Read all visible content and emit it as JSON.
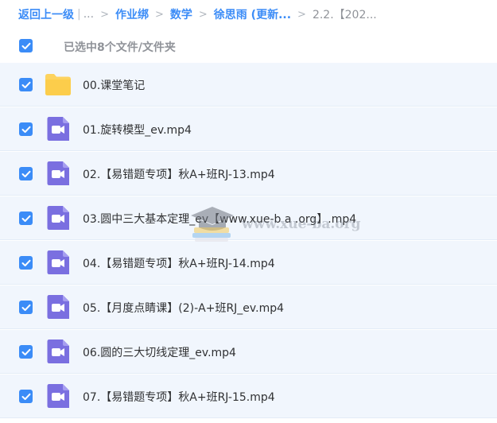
{
  "breadcrumb": {
    "back_label": "返回上一级",
    "bar": "|",
    "ellipsis": "...",
    "separator": ">",
    "items": [
      "作业绑",
      "数学",
      "徐思雨 (更新...",
      "2.2.【202..."
    ]
  },
  "selection": {
    "label": "已选中8个文件/文件夹",
    "checked": true
  },
  "files": [
    {
      "name": "00.课堂笔记",
      "type": "folder",
      "checked": true
    },
    {
      "name": "01.旋转模型_ev.mp4",
      "type": "video",
      "checked": true
    },
    {
      "name": "02.【易错题专项】秋A+班RJ-13.mp4",
      "type": "video",
      "checked": true
    },
    {
      "name": "03.圆中三大基本定理_ev【www.xue-b a .org】.mp4",
      "type": "video",
      "checked": true
    },
    {
      "name": "04.【易错题专项】秋A+班RJ-14.mp4",
      "type": "video",
      "checked": true
    },
    {
      "name": "05.【月度点睛课】(2)-A+班RJ_ev.mp4",
      "type": "video",
      "checked": true
    },
    {
      "name": "06.圆的三大切线定理_ev.mp4",
      "type": "video",
      "checked": true
    },
    {
      "name": "07.【易错题专项】秋A+班RJ-15.mp4",
      "type": "video",
      "checked": true
    }
  ],
  "watermark": {
    "text": "www.xue-ba.org",
    "icon": "graduation-cap-icon"
  },
  "colors": {
    "accent": "#3b8cf7",
    "folder": "#fdd35e",
    "video": "#7a6fe0",
    "row_bg": "#f1f6fd"
  }
}
